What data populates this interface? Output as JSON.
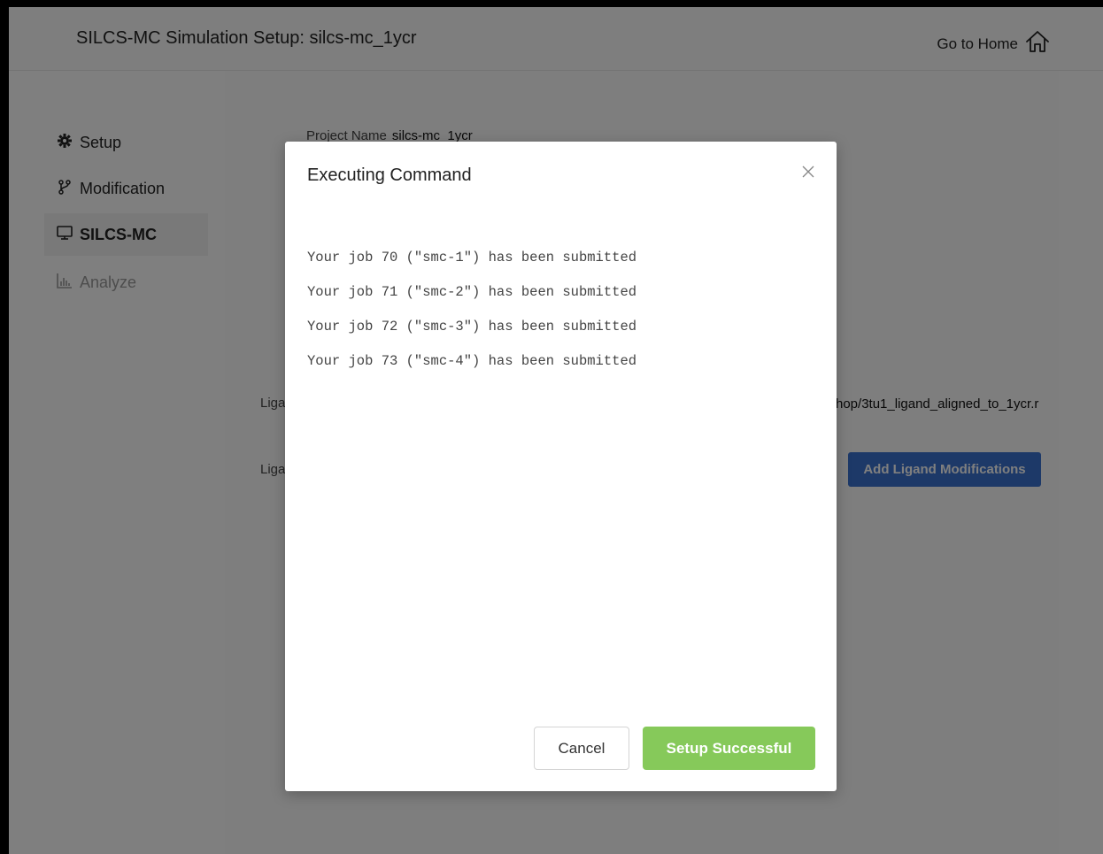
{
  "header": {
    "title": "SILCS-MC Simulation Setup: silcs-mc_1ycr",
    "home_label": "Go to Home"
  },
  "sidebar": {
    "items": [
      {
        "label": "Setup",
        "icon": "gear-icon"
      },
      {
        "label": "Modification",
        "icon": "branch-icon"
      },
      {
        "label": "SILCS-MC",
        "icon": "monitor-icon",
        "active": true
      },
      {
        "label": "Analyze",
        "icon": "bar-chart-icon",
        "disabled": true
      }
    ]
  },
  "main": {
    "project_name_label": "Project Name",
    "project_name_value": "silcs-mc_1ycr",
    "ligand_label_1": "Liga",
    "ligand_path": "hop/3tu1_ligand_aligned_to_1ycr.r",
    "ligand_label_2": "Liga",
    "add_ligand_button": "Add Ligand Modifications"
  },
  "modal": {
    "title": "Executing Command",
    "log_lines": [
      "Your job 70 (\"smc-1\") has been submitted",
      "Your job 71 (\"smc-2\") has been submitted",
      "Your job 72 (\"smc-3\") has been submitted",
      "Your job 73 (\"smc-4\") has been submitted"
    ],
    "cancel_label": "Cancel",
    "success_label": "Setup Successful"
  },
  "colors": {
    "success_button": "#86c95a",
    "primary_button": "#3b73d0",
    "overlay": "rgba(0,0,0,0.5)"
  }
}
